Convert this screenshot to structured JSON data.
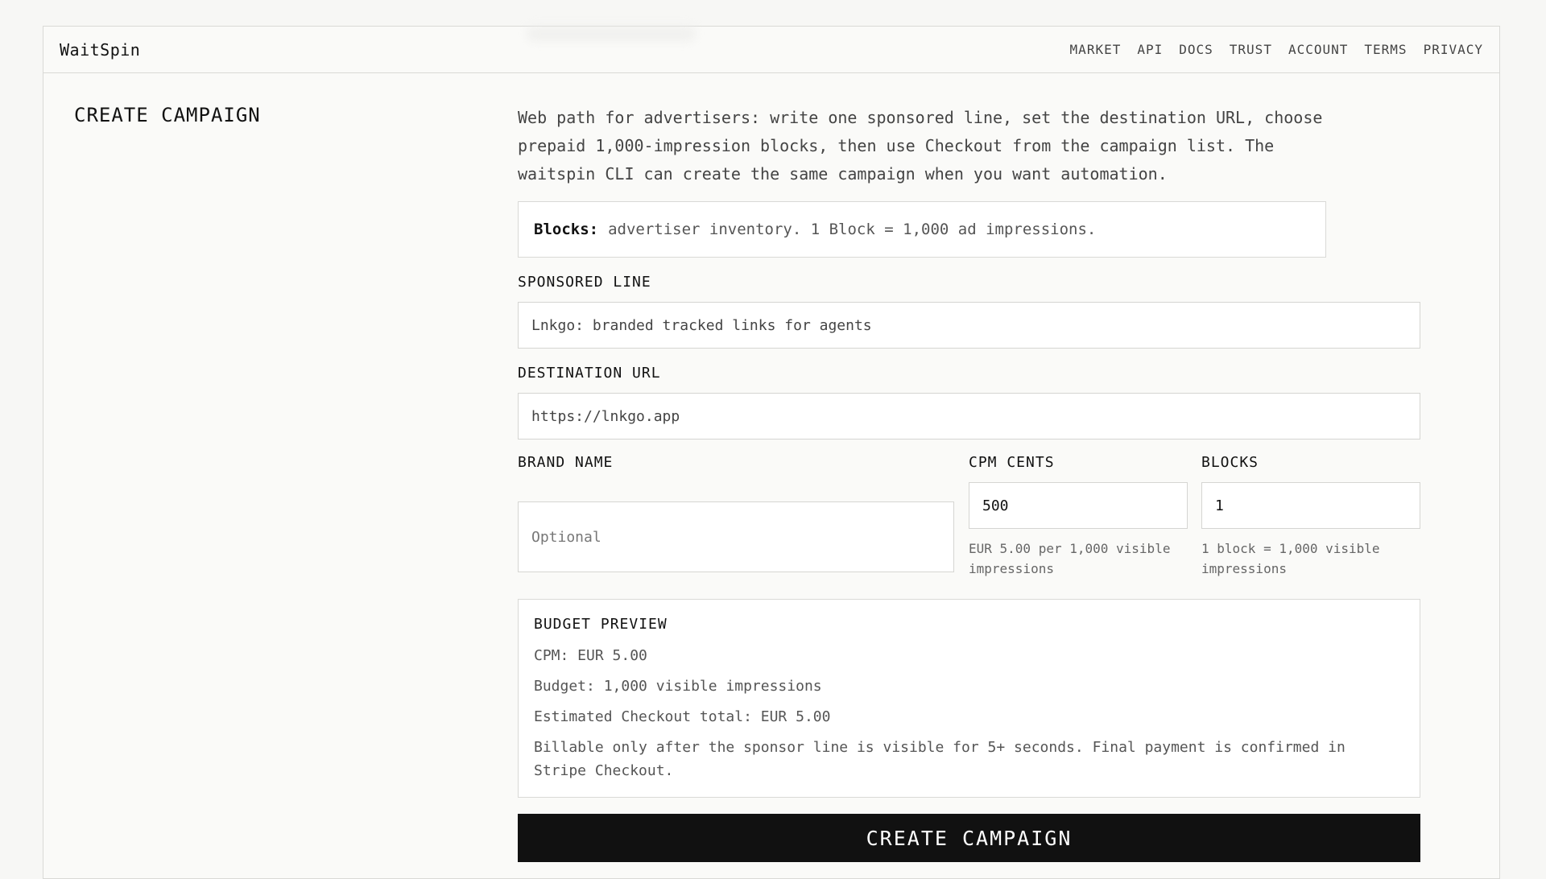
{
  "app": {
    "brand": "WaitSpin"
  },
  "nav": {
    "items": [
      "MARKET",
      "API",
      "DOCS",
      "TRUST",
      "ACCOUNT",
      "TERMS",
      "PRIVACY"
    ]
  },
  "page": {
    "heading": "CREATE CAMPAIGN",
    "intro": "Web path for advertisers: write one sponsored line, set the destination URL, choose prepaid 1,000-impression blocks, then use Checkout from the campaign list. The waitspin CLI can create the same campaign when you want automation.",
    "notice_label": "Blocks:",
    "notice_text": "advertiser inventory. 1 Block = 1,000 ad impressions."
  },
  "form": {
    "sponsored_line": {
      "label": "SPONSORED LINE",
      "value": "Lnkgo: branded tracked links for agents"
    },
    "destination_url": {
      "label": "DESTINATION URL",
      "value": "https://lnkgo.app"
    },
    "brand_name": {
      "label": "BRAND NAME",
      "placeholder": "Optional"
    },
    "cpm_cents": {
      "label": "CPM CENTS",
      "value": "500",
      "hint": "EUR 5.00 per 1,000 visible impressions"
    },
    "blocks": {
      "label": "BLOCKS",
      "value": "1",
      "hint": "1 block = 1,000 visible impressions"
    }
  },
  "preview": {
    "title": "BUDGET PREVIEW",
    "cpm": "CPM: EUR 5.00",
    "budget": "Budget: 1,000 visible impressions",
    "total": "Estimated Checkout total: EUR 5.00",
    "note": "Billable only after the sponsor line is visible for 5+ seconds. Final payment is confirmed in Stripe Checkout."
  },
  "actions": {
    "create_label": "CREATE CAMPAIGN"
  }
}
